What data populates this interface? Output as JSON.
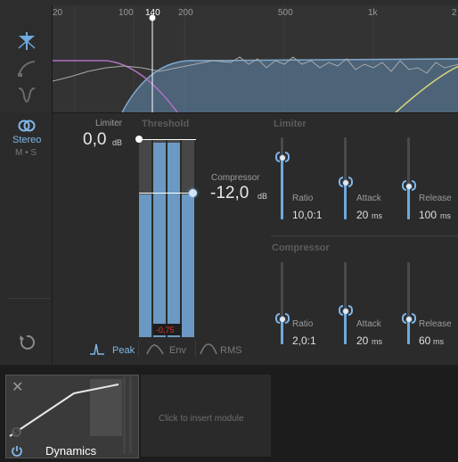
{
  "analyzer": {
    "freq_labels": [
      "20",
      "100",
      "140",
      "200",
      "500",
      "1k",
      "2"
    ]
  },
  "left_panel": {
    "stereo_label": "Stereo",
    "ms_label": "M • S"
  },
  "limiter_block": {
    "label": "Limiter",
    "value": "0,0",
    "unit": "dB"
  },
  "threshold": {
    "label": "Threshold",
    "peak_readout": "-0,75",
    "meter_levels": [
      0.72,
      0.98,
      0.98,
      0.72
    ]
  },
  "compressor_block": {
    "label": "Compressor",
    "value": "-12,0",
    "unit": "dB"
  },
  "detection_modes": {
    "peak": "Peak",
    "env": "Env",
    "rms": "RMS",
    "selected": "Peak"
  },
  "limiter_section": {
    "title": "Limiter",
    "ratio": {
      "label": "Ratio",
      "value": "10,0:1",
      "level": 0.75
    },
    "attack": {
      "label": "Attack",
      "value": "20",
      "unit": "ms",
      "level": 0.45
    },
    "release": {
      "label": "Release",
      "value": "100",
      "unit": "ms",
      "level": 0.4
    }
  },
  "compressor_section": {
    "title": "Compressor",
    "ratio": {
      "label": "Ratio",
      "value": "2,0:1",
      "level": 0.3
    },
    "attack": {
      "label": "Attack",
      "value": "20",
      "unit": "ms",
      "level": 0.4
    },
    "release": {
      "label": "Release",
      "value": "60",
      "unit": "ms",
      "level": 0.3
    }
  },
  "module_strip": {
    "module_name": "Dynamics",
    "empty_slot_text": "Click to insert module"
  },
  "colors": {
    "accent": "#6fa9de",
    "meter_red": "#e0352b",
    "lowcut_curve": "#b06fc1",
    "highcut_curve": "#d8d27a"
  }
}
